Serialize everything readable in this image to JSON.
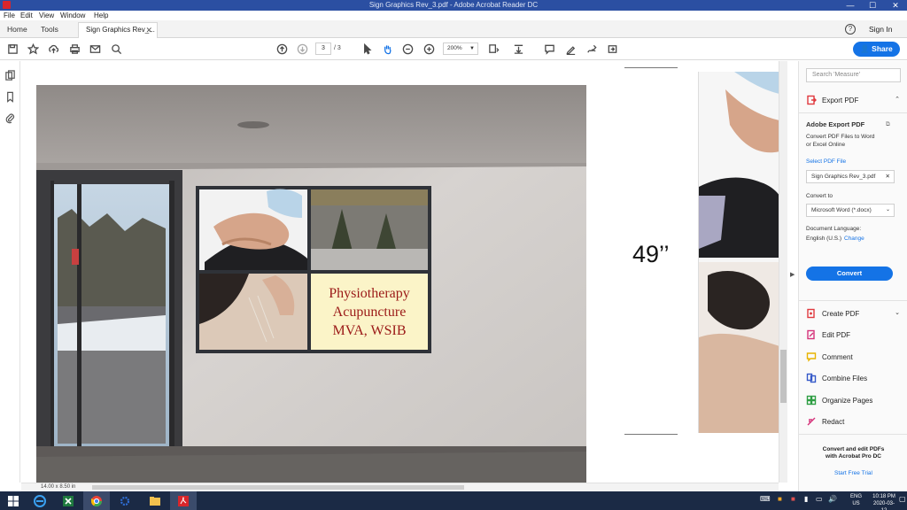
{
  "window": {
    "title": "Sign Graphics Rev_3.pdf - Adobe Acrobat Reader DC",
    "minimize": "—",
    "maximize": "☐",
    "close": "✕"
  },
  "menu": [
    "File",
    "Edit",
    "View",
    "Window",
    "Help"
  ],
  "tabs": {
    "home": "Home",
    "tools": "Tools",
    "document": "Sign Graphics Rev_...",
    "document_close": "✕",
    "help": "?",
    "sign_in": "Sign In"
  },
  "toolbar": {
    "page_current": "3",
    "page_total": "/ 3",
    "zoom": "200%",
    "share": "Share"
  },
  "document": {
    "window_sign": {
      "line1": "Physiotherapy",
      "line2": "Acupuncture",
      "line3": "MVA, WSIB"
    },
    "dimension": "49’’",
    "page_size": "14.00 x 8.50 in"
  },
  "right_pane": {
    "search_placeholder": "Search 'Measure'",
    "export_pdf": "Export PDF",
    "adobe_export_title": "Adobe Export PDF",
    "adobe_export_desc1": "Convert PDF Files to Word",
    "adobe_export_desc2": "or Excel Online",
    "select_file_label": "Select PDF File",
    "selected_file": "Sign Graphics Rev_3.pdf",
    "convert_to_label": "Convert to",
    "convert_to_value": "Microsoft Word (*.docx)",
    "doc_language_label": "Document Language:",
    "doc_language_value": "English (U.S.)",
    "change_link": "Change",
    "convert_button": "Convert",
    "tools": [
      {
        "label": "Create PDF",
        "icon": "create-pdf-icon",
        "color": "#e0393e"
      },
      {
        "label": "Edit PDF",
        "icon": "edit-pdf-icon",
        "color": "#d5327a"
      },
      {
        "label": "Comment",
        "icon": "comment-icon",
        "color": "#e8b300"
      },
      {
        "label": "Combine Files",
        "icon": "combine-files-icon",
        "color": "#3458c8"
      },
      {
        "label": "Organize Pages",
        "icon": "organize-pages-icon",
        "color": "#2f9e44"
      },
      {
        "label": "Redact",
        "icon": "redact-icon",
        "color": "#d5327a"
      }
    ],
    "promo_line1": "Convert and edit PDFs",
    "promo_line2": "with Acrobat Pro DC",
    "start_trial": "Start Free Trial"
  },
  "taskbar": {
    "lang1": "ENG",
    "lang2": "US",
    "time": "10:18 PM",
    "date": "2020-03-12"
  },
  "colors": {
    "accent": "#1473e6",
    "titlebar": "#2b4fa2",
    "taskbar": "#1b2a45"
  }
}
